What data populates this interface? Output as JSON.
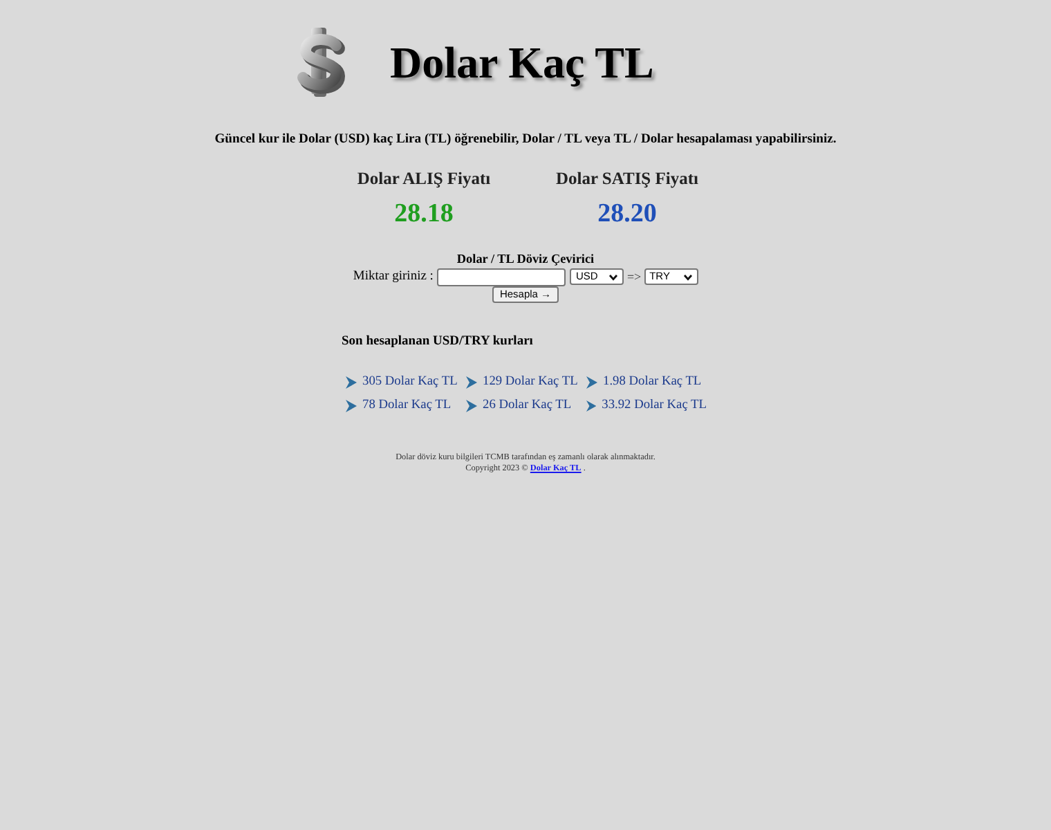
{
  "header": {
    "title": "Dolar Kaç TL"
  },
  "intro": "Güncel kur ile Dolar (USD) kaç Lira (TL) öğrenebilir, Dolar / TL veya TL / Dolar hesapalaması yapabilirsiniz.",
  "rates": [
    {
      "label": "Dolar ALIŞ Fiyatı",
      "value": "28.18",
      "color": "#1f9e1f"
    },
    {
      "label": "Dolar SATIŞ Fiyatı",
      "value": "28.20",
      "color": "#1f4fb8"
    }
  ],
  "converter": {
    "title": "Dolar / TL Döviz Çevirici",
    "amount_label": "Miktar giriniz :",
    "from_currency": "USD",
    "separator": "=>",
    "to_currency": "TRY",
    "button": "Hesapla →"
  },
  "recent": {
    "title": "Son hesaplanan USD/TRY kurları",
    "links": [
      "305 Dolar Kaç TL",
      "129 Dolar Kaç TL",
      "1.98 Dolar Kaç TL",
      "78 Dolar Kaç TL",
      "26 Dolar Kaç TL",
      "33.92 Dolar Kaç TL"
    ]
  },
  "footer": {
    "note": "Dolar döviz kuru bilgileri TCMB tarafından eş zamanlı olarak alınmaktadır.",
    "copyright": "Copyright 2023 ©",
    "link": "Dolar Kaç TL",
    "trailing": "."
  }
}
